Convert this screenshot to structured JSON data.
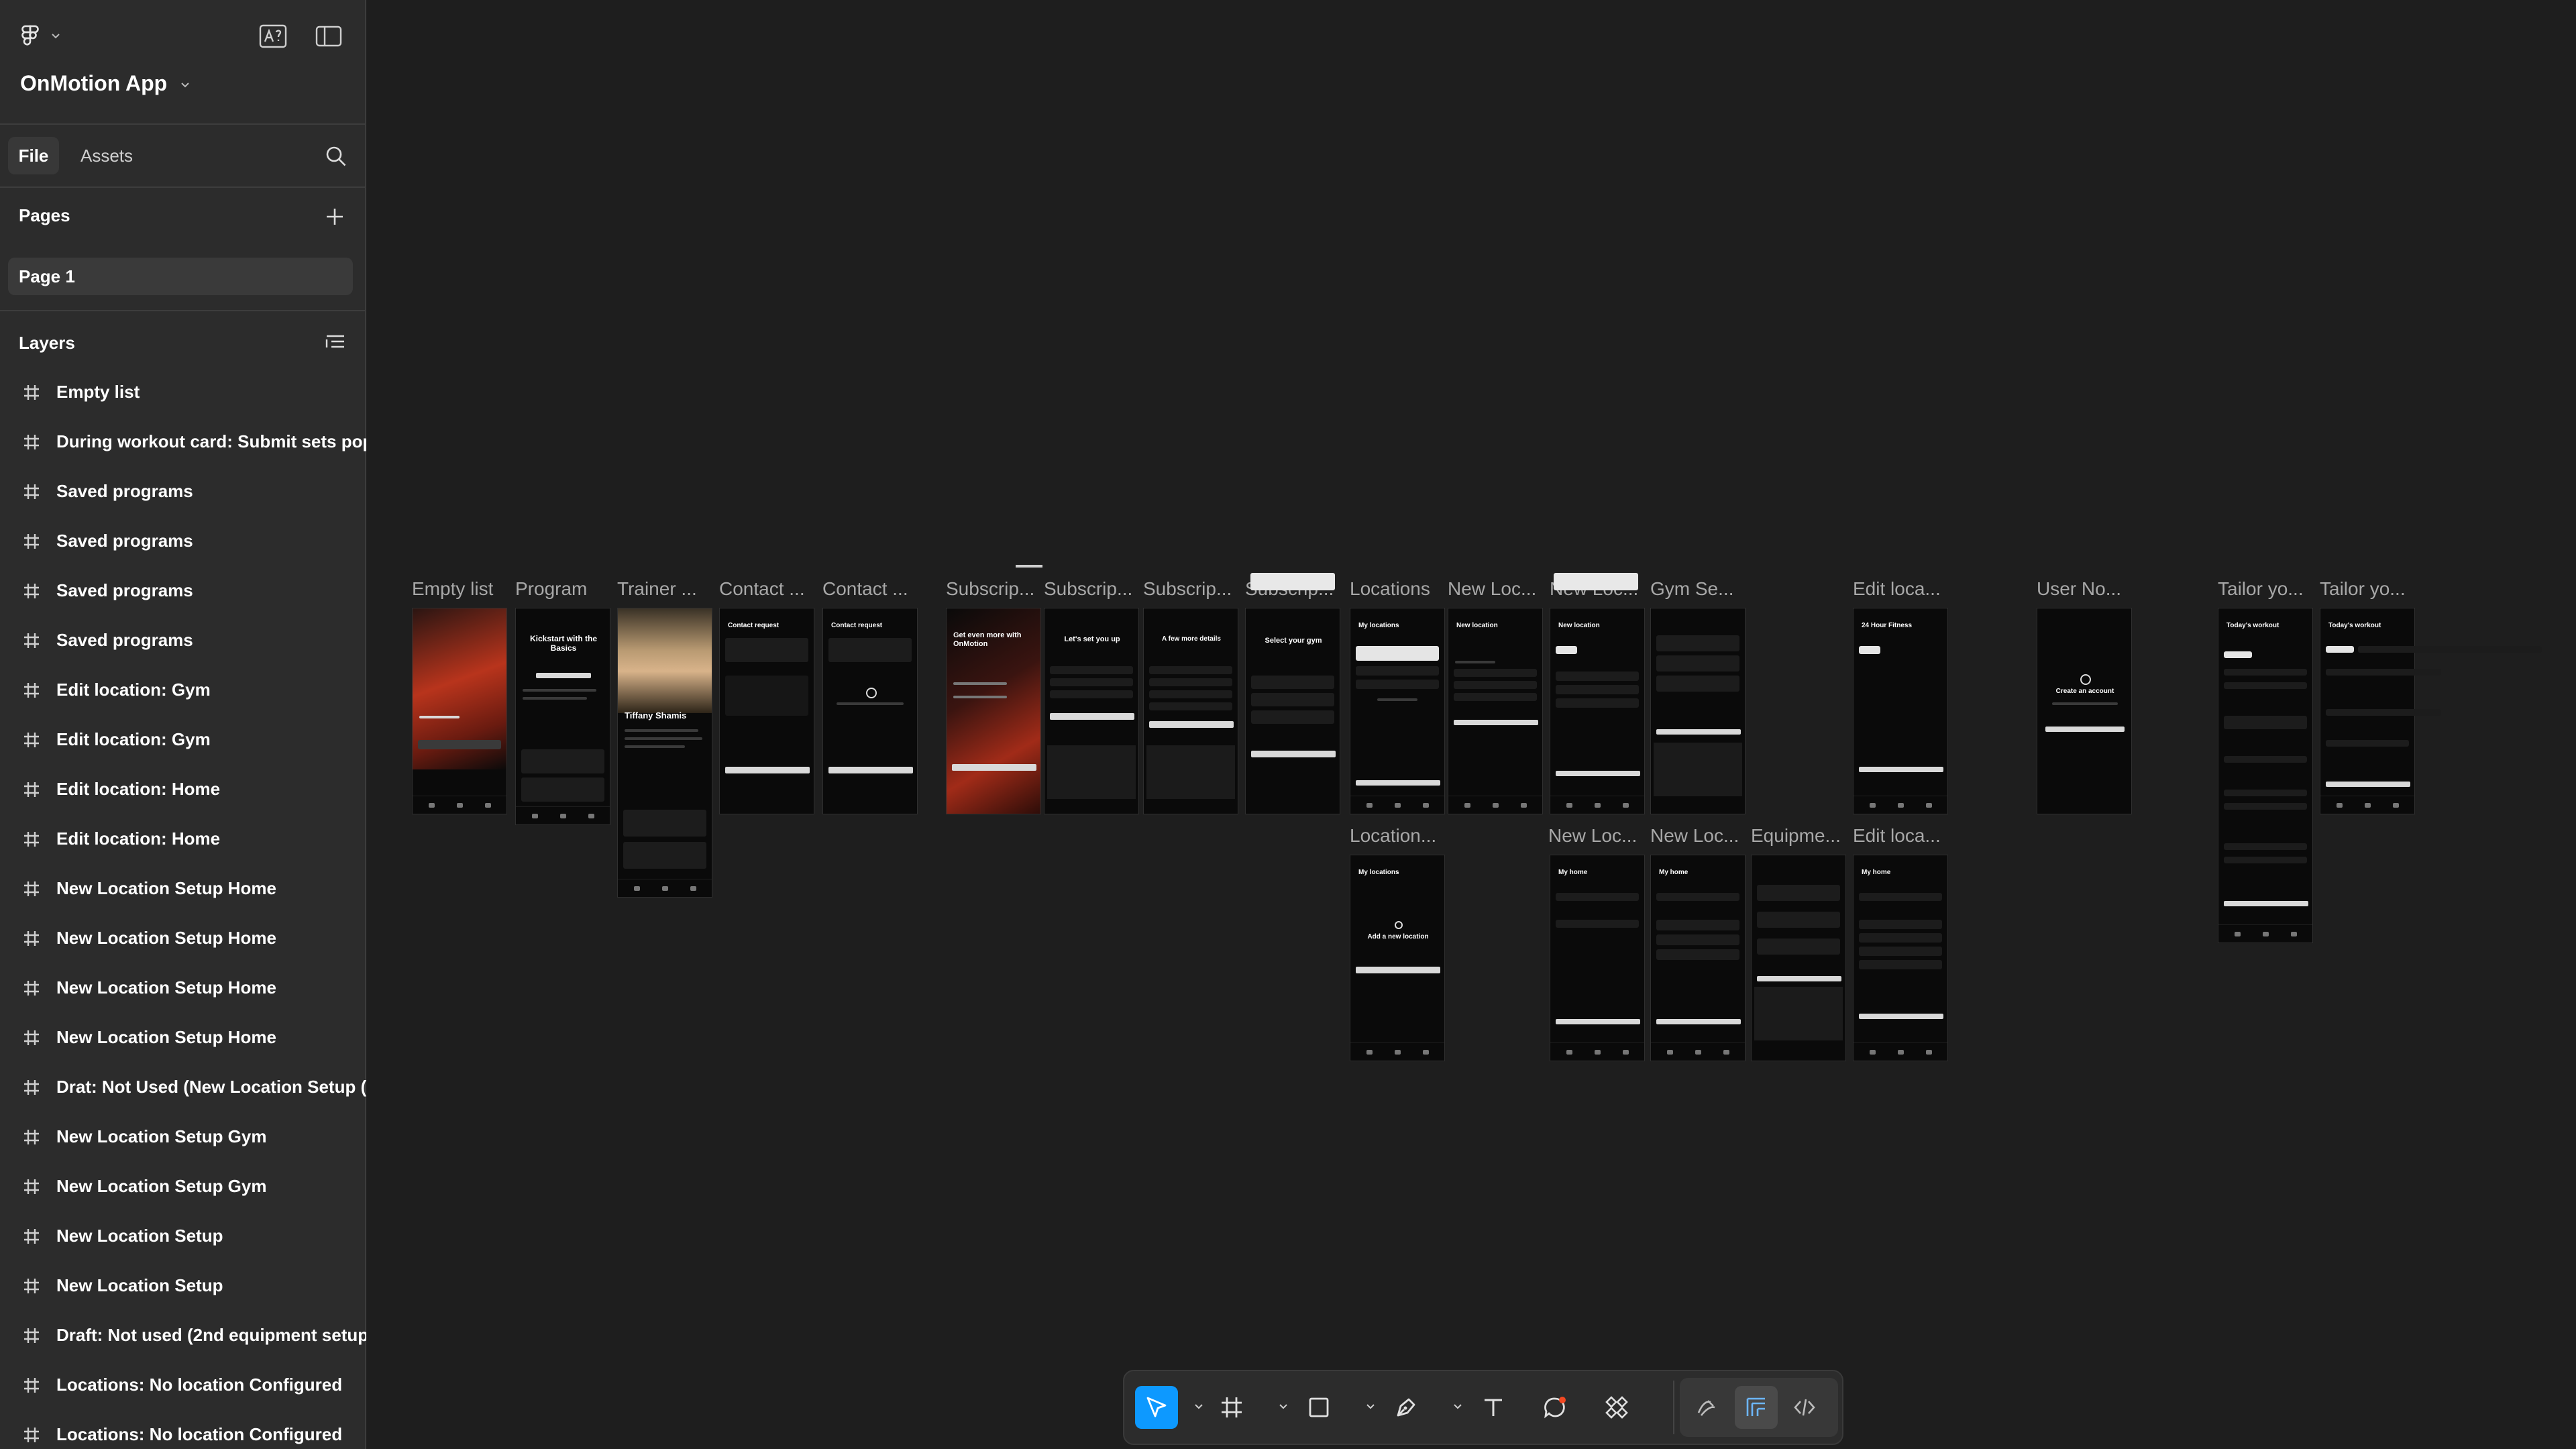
{
  "app": {
    "project_name": "OnMotion App",
    "accent_color": "#0d99ff"
  },
  "sidebar": {
    "tabs": [
      {
        "label": "File",
        "active": true
      },
      {
        "label": "Assets",
        "active": false
      }
    ],
    "pages_heading": "Pages",
    "pages": [
      {
        "label": "Page 1",
        "selected": true
      }
    ],
    "layers_heading": "Layers",
    "layers": [
      "Empty list",
      "During workout card: Submit sets pop",
      "Saved programs",
      "Saved programs",
      "Saved programs",
      "Saved programs",
      "Edit location: Gym",
      "Edit location: Gym",
      "Edit location: Home",
      "Edit location: Home",
      "New Location Setup Home",
      "New Location Setup Home",
      "New Location Setup Home",
      "New Location Setup Home",
      "Drat: Not Used (New Location Setup (",
      "New Location Setup Gym",
      "New Location Setup Gym",
      "New Location Setup",
      "New Location Setup",
      "Draft: Not used (2nd equipment setup",
      "Locations: No location Configured",
      "Locations: No location Configured"
    ]
  },
  "canvas": {
    "frame_labels": [
      "Empty list",
      "Program",
      "Trainer ...",
      "Contact ...",
      "Contact ...",
      "Subscrip...",
      "Subscrip...",
      "Subscrip...",
      "Subscrip...",
      "Locations",
      "New Loc...",
      "New Loc...",
      "Gym Se...",
      "Edit loca...",
      "User No...",
      "Tailor yo...",
      "Tailor yo...",
      "Location...",
      "New Loc...",
      "New Loc...",
      "Equipme...",
      "Edit loca..."
    ],
    "frame_texts": {
      "program_headline": "Kickstart with the Basics",
      "trainer_name": "Tiffany Shamis",
      "contact_title": "Contact request",
      "subscribe_headline": "Get even more with OnMotion",
      "setup_headline": "Let's set you up",
      "details_headline": "A few more details",
      "gym_headline": "Select your gym",
      "locations_title": "My locations",
      "new_location_title": "New location",
      "gym_name": "24 Hour Fitness",
      "account_headline": "Create an account",
      "workout_title": "Today's workout",
      "add_location_headline": "Add a new location",
      "my_home_title": "My home"
    }
  },
  "toolbar": {
    "tools": [
      {
        "name": "move",
        "active": true
      },
      {
        "name": "frame",
        "active": false
      },
      {
        "name": "rectangle",
        "active": false
      },
      {
        "name": "pen",
        "active": false
      },
      {
        "name": "text",
        "active": false
      },
      {
        "name": "comment",
        "active": false
      },
      {
        "name": "components",
        "active": false
      },
      {
        "name": "draw",
        "active": false
      },
      {
        "name": "design-mode",
        "active": true
      },
      {
        "name": "dev-mode",
        "active": false
      }
    ]
  }
}
